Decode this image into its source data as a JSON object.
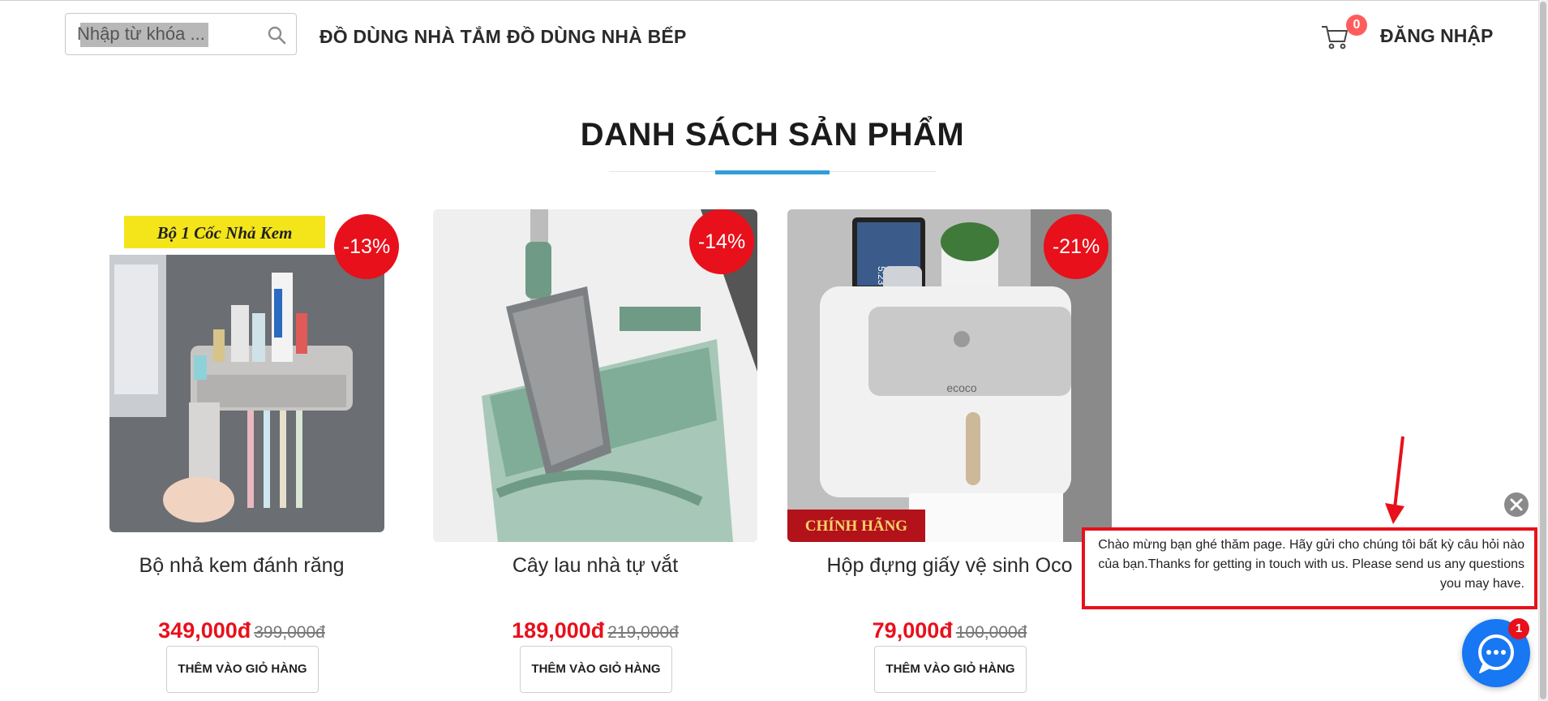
{
  "header": {
    "search": {
      "placeholder": "Nhập từ khóa ..."
    },
    "nav": [
      {
        "label": "ĐỒ DÙNG NHÀ TẮM"
      },
      {
        "label": "ĐỒ DÙNG NHÀ BẾP"
      }
    ],
    "cart": {
      "count": "0"
    },
    "login_label": "ĐĂNG NHẬP"
  },
  "main": {
    "section_title": "DANH SÁCH SẢN PHẨM",
    "products": [
      {
        "name": "Bộ nhả kem đánh răng",
        "discount": "-13%",
        "price": "349,000đ",
        "old_price": "399,000đ",
        "button_label": "THÊM VÀO GIỎ HÀNG",
        "image_banner": "Bộ 1 Cốc Nhả Kem"
      },
      {
        "name": "Cây lau nhà tự vắt",
        "discount": "-14%",
        "price": "189,000đ",
        "old_price": "219,000đ",
        "button_label": "THÊM VÀO GIỎ HÀNG"
      },
      {
        "name": "Hộp đựng giấy vệ sinh Oco",
        "discount": "-21%",
        "price": "79,000đ",
        "old_price": "100,000đ",
        "button_label": "THÊM VÀO GIỎ HÀNG",
        "image_brand": "ecoco",
        "image_stamp": "CHÍNH HÃNG",
        "image_clock": "5:23"
      }
    ]
  },
  "chat": {
    "greeting": "Chào mừng bạn ghé thăm page. Hãy gửi cho chúng tôi bất kỳ câu hỏi nào của bạn.Thanks for getting in touch with us. Please send us any questions you may have.",
    "unread": "1"
  },
  "colors": {
    "sale_red": "#e8101b",
    "accent_blue": "#2f9fd8",
    "messenger_blue": "#1877f2",
    "badge_red": "#ff5c5c"
  }
}
